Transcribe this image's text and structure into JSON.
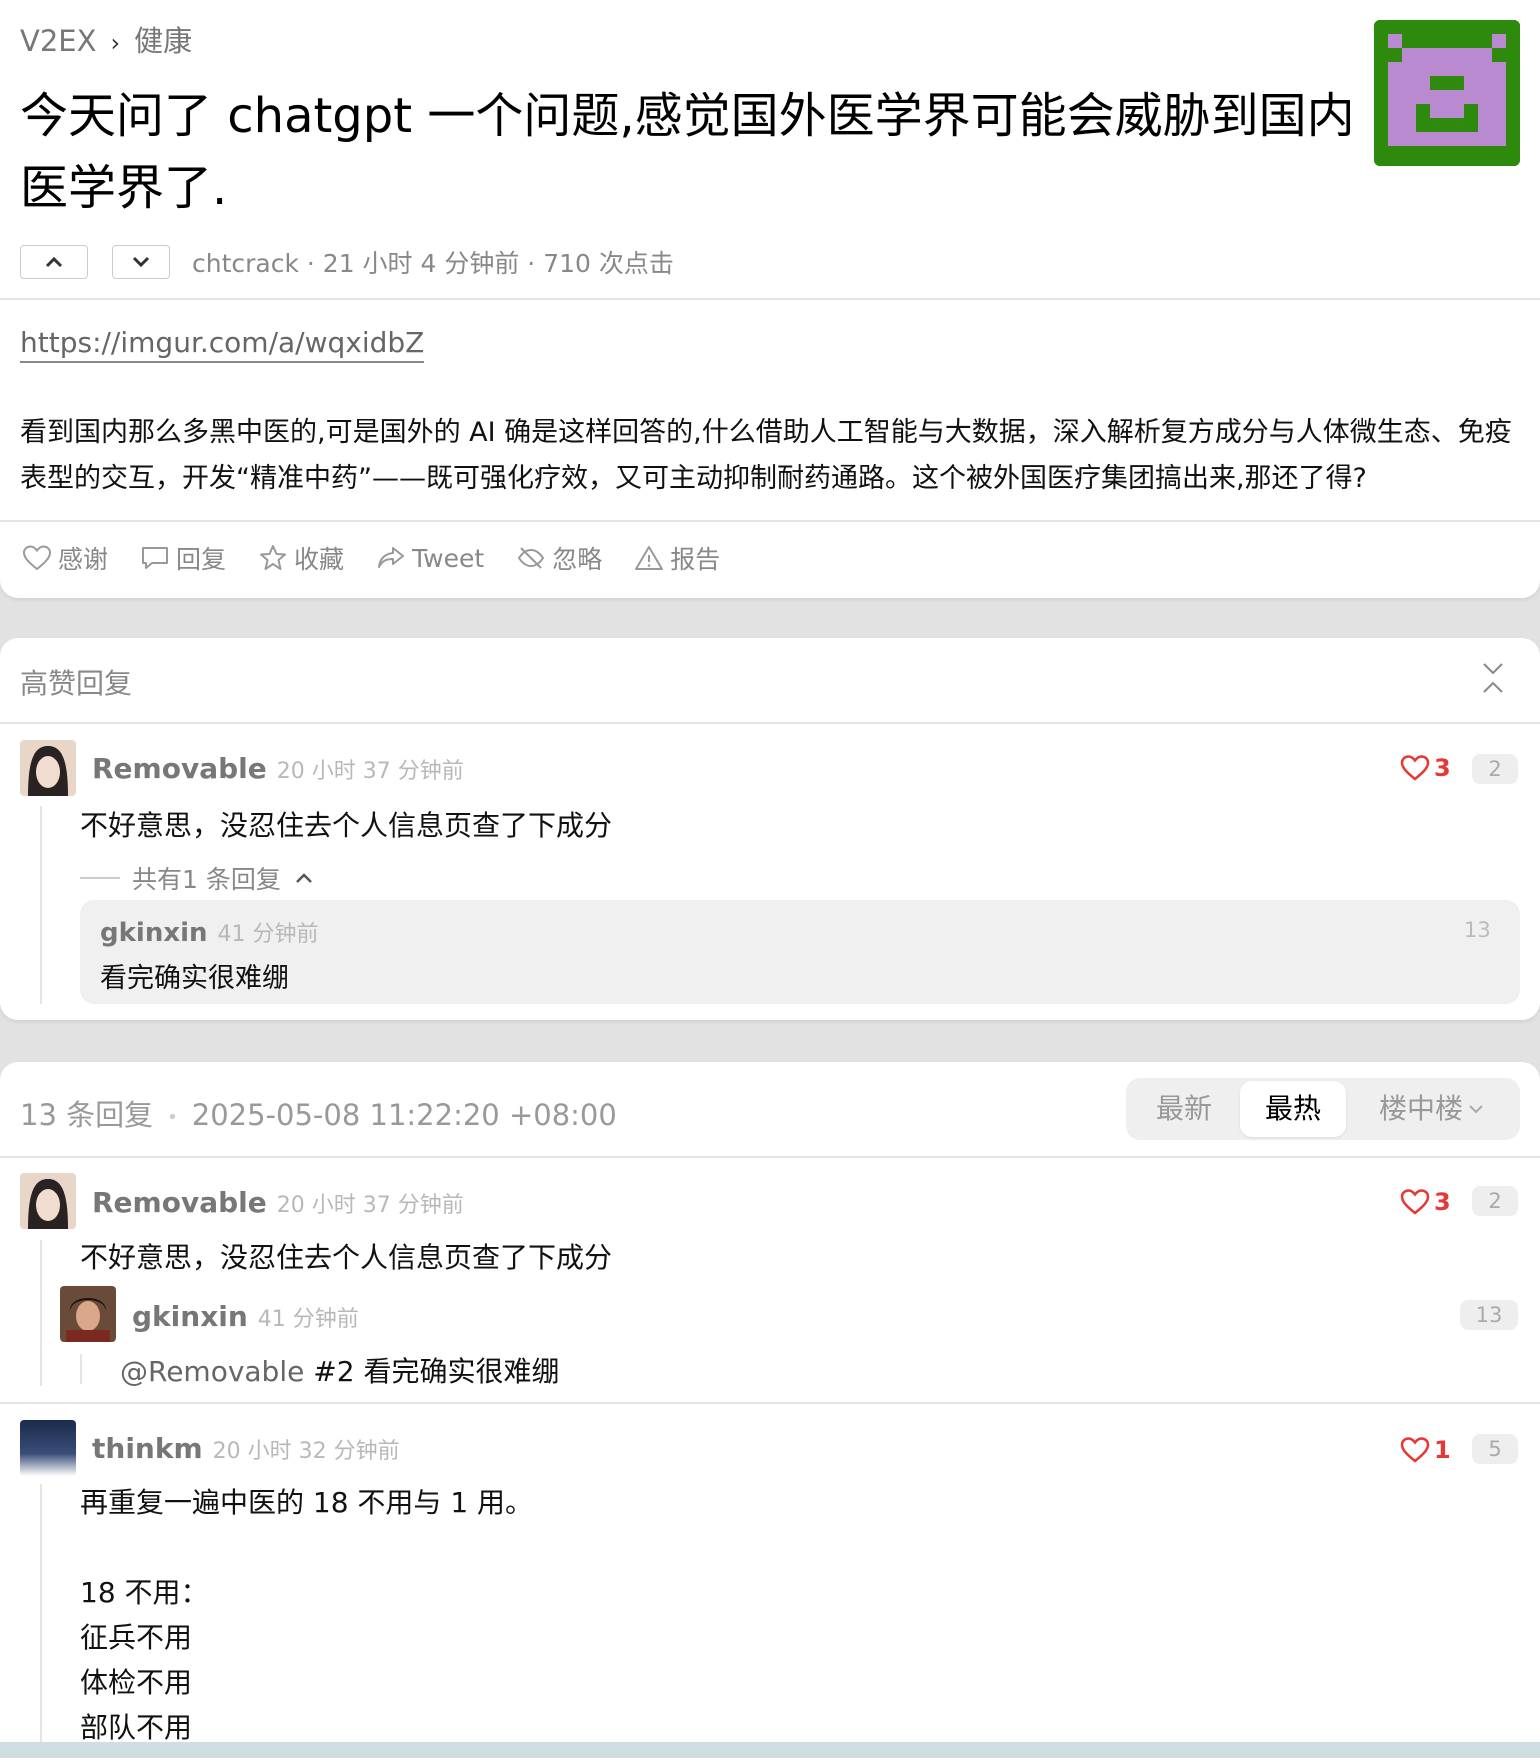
{
  "breadcrumb": {
    "site": "V2EX",
    "separator": "›",
    "node": "健康"
  },
  "topic": {
    "title": "今天问了 chatgpt 一个问题,感觉国外医学界可能会威胁到国内医学界了.",
    "meta": "chtcrack · 21 小时 4 分钟前 · 710 次点击",
    "link": "https://imgur.com/a/wqxidbZ",
    "content": "看到国内那么多黑中医的,可是国外的 AI 确是这样回答的,什么借助人工智能与大数据，深入解析复方成分与人体微生态、免疫表型的交互，开发“精准中药”——既可强化疗效，又可主动抑制耐药通路。这个被外国医疗集团搞出来,那还了得?"
  },
  "actions": {
    "thank": "感谢",
    "reply": "回复",
    "favorite": "收藏",
    "tweet": "Tweet",
    "ignore": "忽略",
    "report": "报告"
  },
  "hot": {
    "title": "高赞回复",
    "reply": {
      "user": "Removable",
      "time": "20 小时 37 分钟前",
      "likes": "3",
      "floor": "2",
      "text": "不好意思，没忍住去个人信息页查了下成分",
      "sub_count": "共有1 条回复",
      "sub": {
        "user": "gkinxin",
        "time": "41 分钟前",
        "floor": "13",
        "text": "看完确实很难绷"
      }
    }
  },
  "list": {
    "count": "13 条回复",
    "dot": "•",
    "datetime": "2025-05-08 11:22:20 +08:00",
    "tabs": {
      "latest": "最新",
      "hot": "最热",
      "nested": "楼中楼"
    },
    "r1": {
      "user": "Removable",
      "time": "20 小时 37 分钟前",
      "likes": "3",
      "floor": "2",
      "text": "不好意思，没忍住去个人信息页查了下成分",
      "child": {
        "user": "gkinxin",
        "time": "41 分钟前",
        "floor": "13",
        "mention": "@Removable",
        "ref": "#2",
        "text": "看完确实很难绷"
      }
    },
    "r2": {
      "user": "thinkm",
      "time": "20 小时 32 分钟前",
      "likes": "1",
      "floor": "5",
      "lines": [
        "再重复一遍中医的 18 不用与 1 用。",
        "",
        "18 不用：",
        "征兵不用",
        "体检不用",
        "部队不用"
      ]
    }
  },
  "colors": {
    "heart": "#e53935",
    "avatar_bg": "#2d8a0d",
    "avatar_fg": "#b98ad0"
  }
}
